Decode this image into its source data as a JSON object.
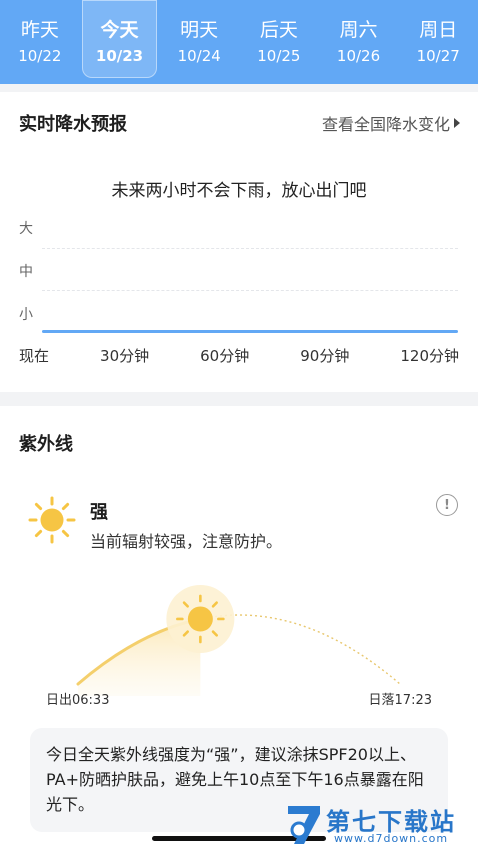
{
  "tabs": [
    {
      "name": "昨天",
      "date": "10/22"
    },
    {
      "name": "今天",
      "date": "10/23"
    },
    {
      "name": "明天",
      "date": "10/24"
    },
    {
      "name": "后天",
      "date": "10/25"
    },
    {
      "name": "周六",
      "date": "10/26"
    },
    {
      "name": "周日",
      "date": "10/27"
    }
  ],
  "active_tab_index": 1,
  "precip": {
    "title": "实时降水预报",
    "link": "查看全国降水变化",
    "summary": "未来两小时不会下雨，放心出门吧",
    "levels": [
      "大",
      "中",
      "小"
    ],
    "times": [
      "现在",
      "30分钟",
      "60分钟",
      "90分钟",
      "120分钟"
    ]
  },
  "uv": {
    "title": "紫外线",
    "level": "强",
    "desc": "当前辐射较强，注意防护。",
    "info": "!",
    "sunrise": "日出06:33",
    "sunset": "日落17:23",
    "sun_progress": 0.38,
    "advice": "今日全天紫外线强度为“强”，建议涂抹SPF20以上、PA+防晒护肤品，避免上午10点至下午16点暴露在阳光下。"
  },
  "watermark": {
    "text": "第七下载站",
    "url": "www.d7down.com"
  },
  "colors": {
    "header": "#62a8f5",
    "accent_line": "#62a8f5",
    "sun": "#f6c544",
    "arc": "#f4d27a"
  }
}
